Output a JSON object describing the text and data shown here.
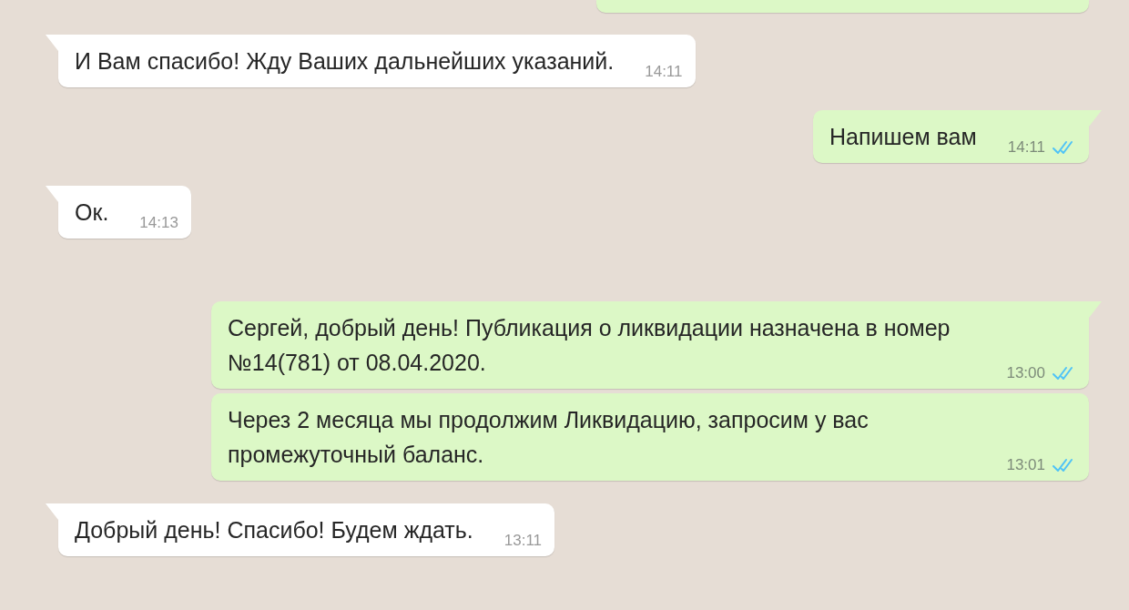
{
  "messages": [
    {
      "outgoing": true,
      "cut_off": true
    },
    {
      "outgoing": false,
      "tail": true,
      "text": "И Вам спасибо! Жду Ваших дальнейших указаний.",
      "time": "14:11"
    },
    {
      "outgoing": true,
      "tail": true,
      "text": "Напишем вам",
      "time": "14:11",
      "read": true
    },
    {
      "outgoing": false,
      "tail": true,
      "text": "Ок.",
      "time": "14:13"
    },
    {
      "outgoing": true,
      "tail": true,
      "text": "Сергей, добрый день! Публикация о ликвидации назначена в номер №14(781) от 08.04.2020.",
      "time": "13:00",
      "read": true
    },
    {
      "outgoing": true,
      "tail": false,
      "text": "Через 2 месяца мы продолжим Ликвидацию, запросим у вас промежуточный баланс.",
      "time": "13:01",
      "read": true
    },
    {
      "outgoing": false,
      "tail": true,
      "text": "Добрый день! Спасибо! Будем ждать.",
      "time": "13:11"
    }
  ]
}
